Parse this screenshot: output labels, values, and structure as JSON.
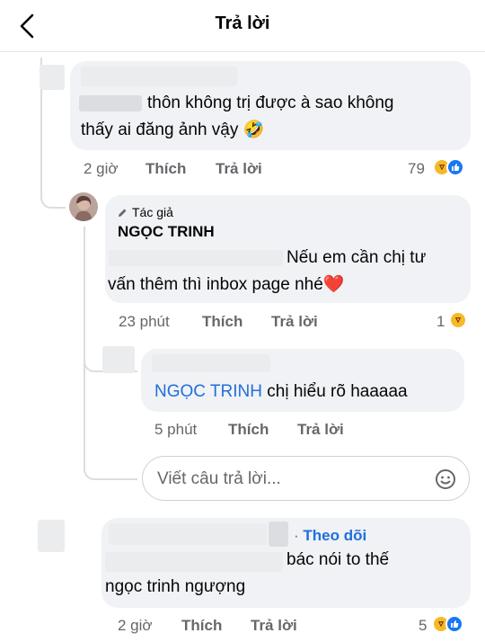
{
  "header": {
    "title": "Trả lời",
    "back_icon": "chevron-left-icon"
  },
  "comment1": {
    "text_line1": "thôn không trị được à sao không",
    "text_line2": "thấy ai đăng ảnh vậy",
    "text_emoji": "🤣",
    "time": "2 giờ",
    "like_label": "Thích",
    "reply_label": "Trả lời",
    "reaction_count": "79"
  },
  "reply1": {
    "badge": "Tác giả",
    "author": "NGỌC TRINH",
    "text_line1": "Nếu em cần chị tư",
    "text_line2": "vấn thêm thì inbox page nhé",
    "text_emoji": "❤️",
    "time": "23 phút",
    "like_label": "Thích",
    "reply_label": "Trả lời",
    "reaction_count": "1"
  },
  "reply2": {
    "mention": "NGỌC TRINH",
    "text": "chị hiểu rõ haaaaa",
    "time": "5 phút",
    "like_label": "Thích",
    "reply_label": "Trả lời"
  },
  "reply_input": {
    "placeholder": "Viết câu trả lời..."
  },
  "comment2": {
    "follow_dot": "·",
    "follow_label": "Theo dõi",
    "text_line1": "bác nói to thế",
    "text_line2": "ngọc trinh ngượng",
    "time": "2 giờ",
    "like_label": "Thích",
    "reply_label": "Trả lời",
    "reaction_count": "5"
  },
  "colors": {
    "accent": "#216fdb",
    "like_blue": "#1877f2",
    "haha_yellow": "#f7b928",
    "bubble": "#f0f2f5",
    "meta": "#65676b"
  }
}
